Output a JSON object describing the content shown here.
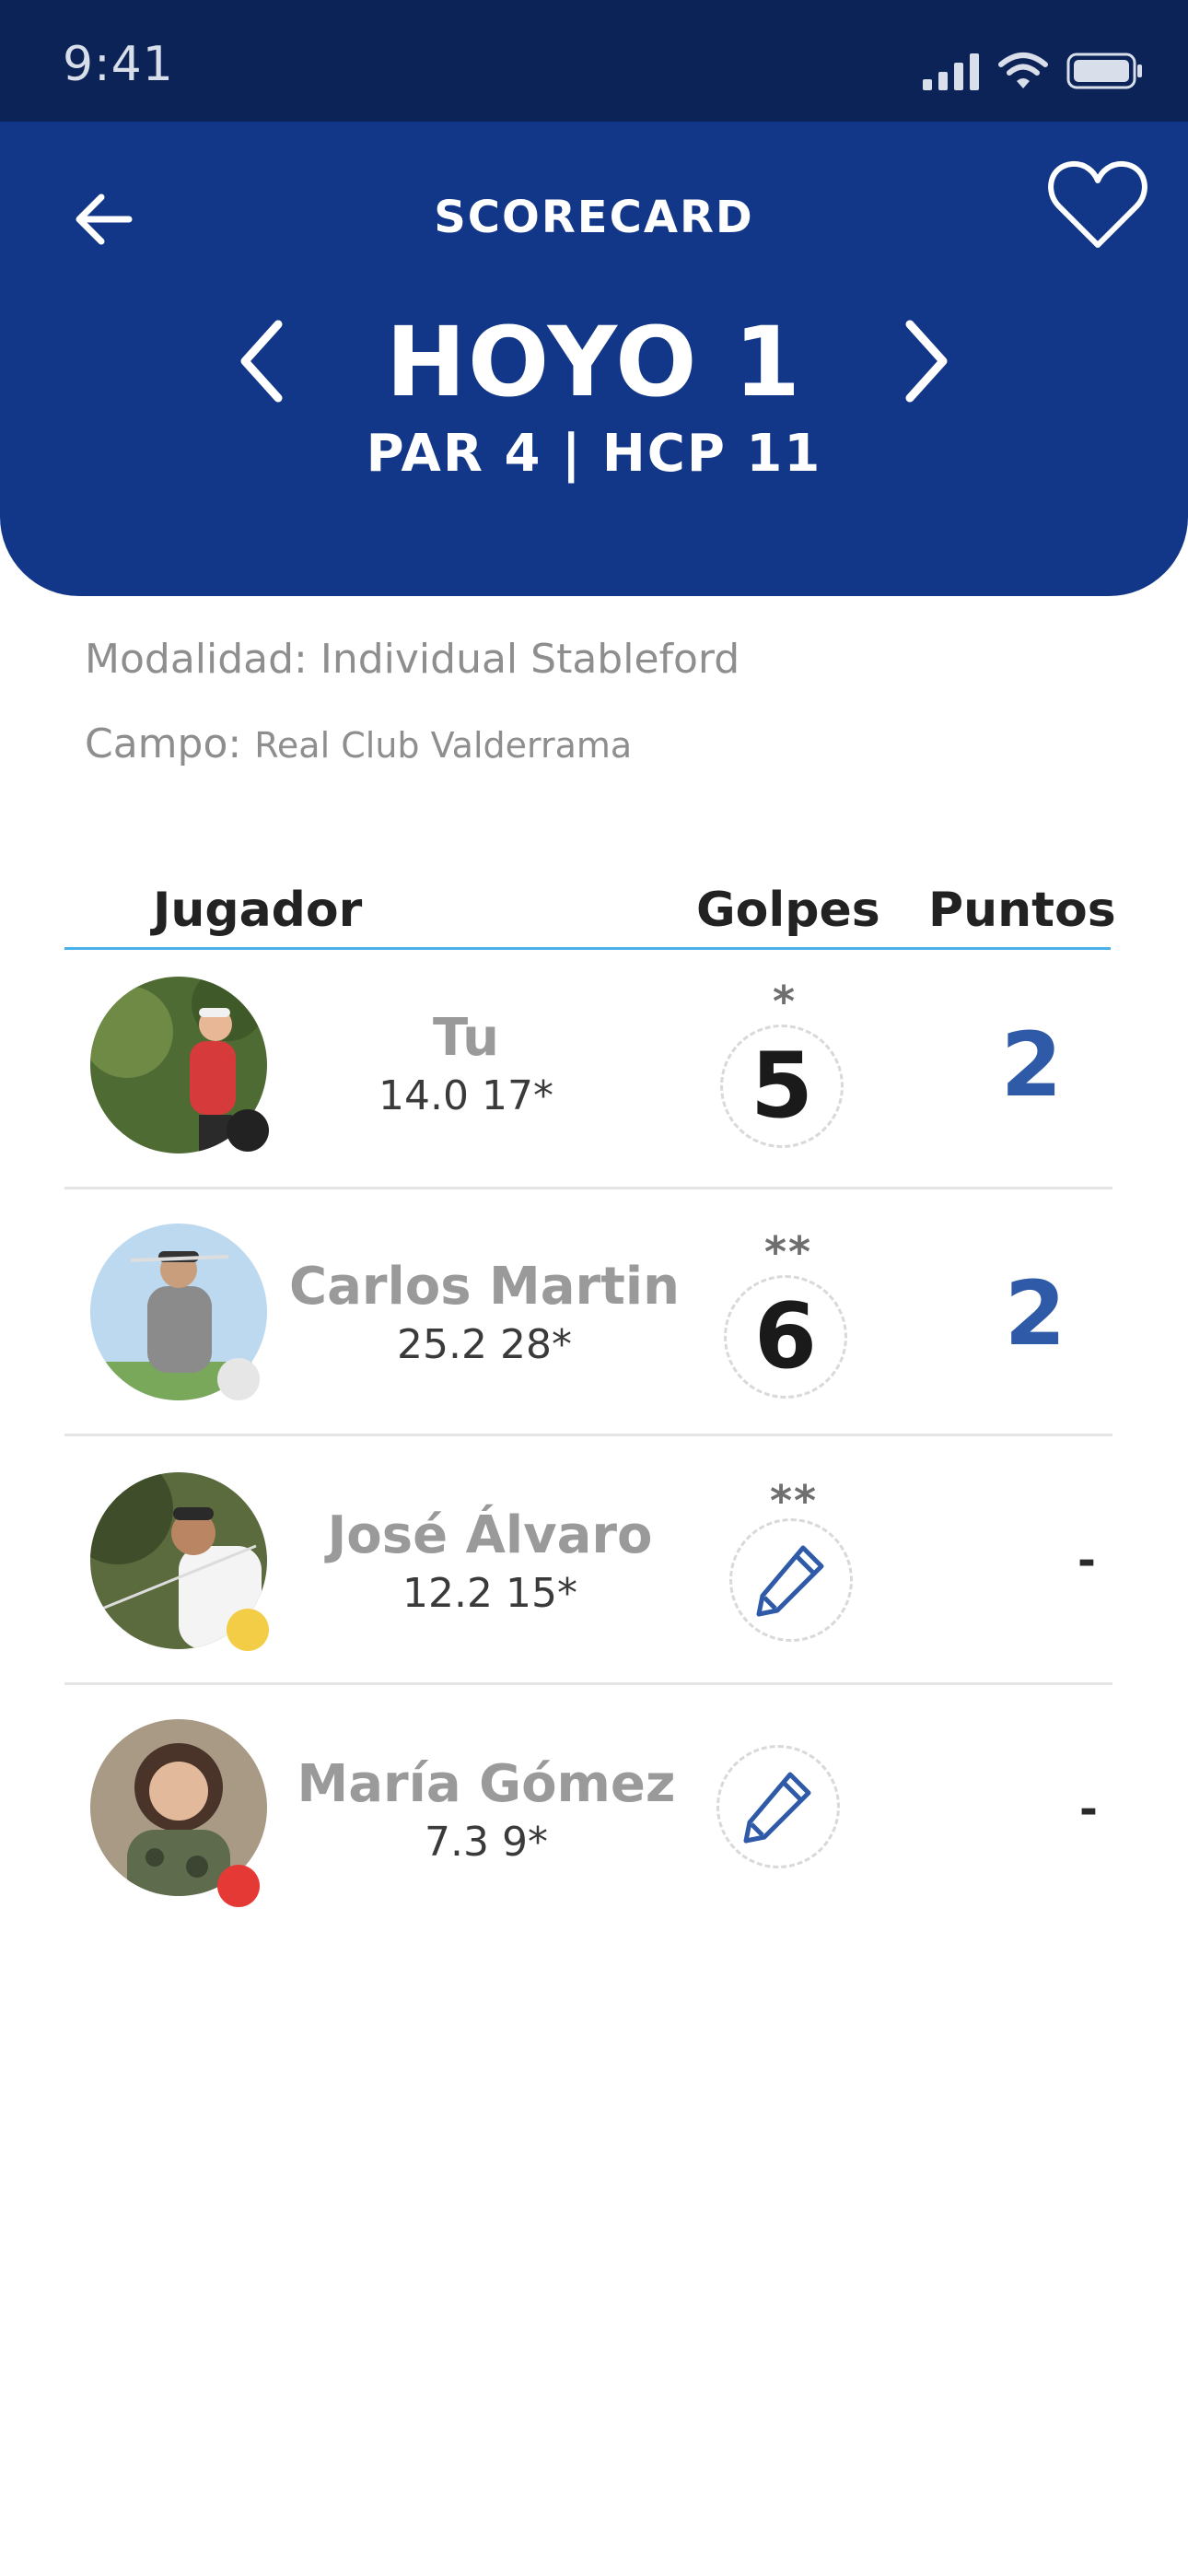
{
  "status": {
    "time": "9:41"
  },
  "header": {
    "title": "SCORECARD",
    "hole_title": "HOYO 1",
    "hole_info": "PAR 4  |  HCP 11"
  },
  "details": {
    "mode_label": "Modalidad:",
    "mode_value": "Individual Stableford",
    "course_label": "Campo:",
    "course_value": "Real Club Valderrama"
  },
  "table": {
    "col_player": "Jugador",
    "col_shots": "Golpes",
    "col_points": "Puntos"
  },
  "players": [
    {
      "name": "Tu",
      "hcp": "14.0  17*",
      "stars": "*",
      "shots": "5",
      "points": "2",
      "dot_color": "#222222"
    },
    {
      "name": "Carlos Martin",
      "hcp": "25.2  28*",
      "stars": "**",
      "shots": "6",
      "points": "2",
      "dot_color": "#e6e6e6"
    },
    {
      "name": "José Álvaro",
      "hcp": "12.2  15*",
      "stars": "**",
      "shots": "",
      "points": "-",
      "dot_color": "#f2cd45"
    },
    {
      "name": "María Gómez",
      "hcp": "7.3  9*",
      "stars": "",
      "shots": "",
      "points": "-",
      "dot_color": "#e53935"
    }
  ],
  "colors": {
    "status_bar": "#0c2358",
    "header": "#123788",
    "accent_line": "#4bb0e8",
    "points": "#2f5aa8"
  }
}
